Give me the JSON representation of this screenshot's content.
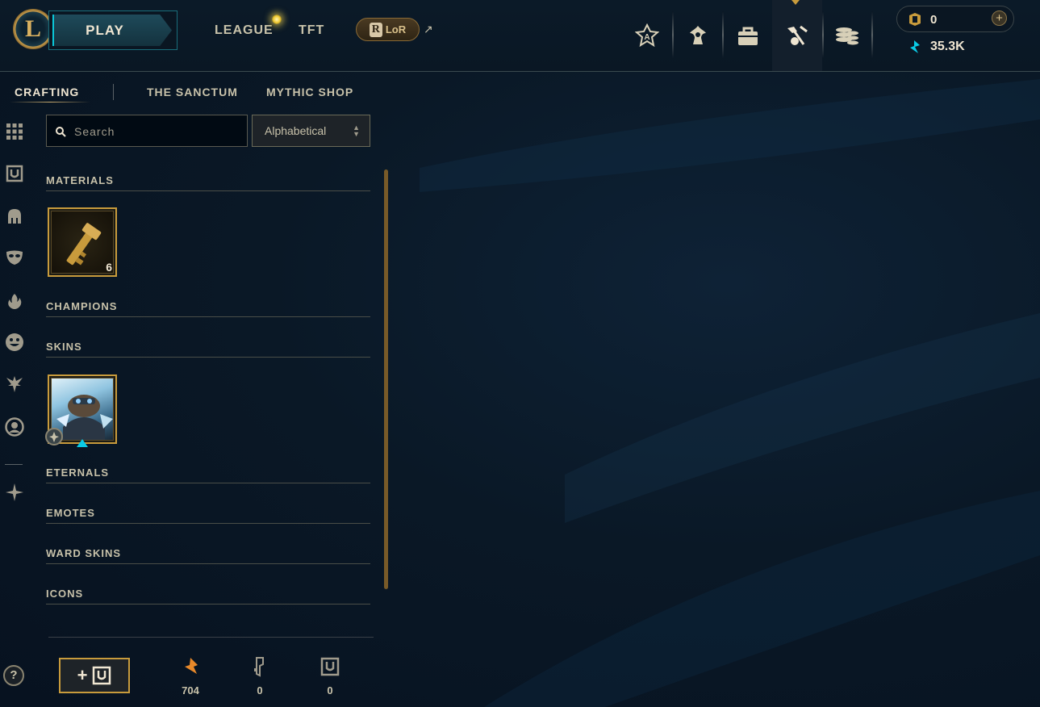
{
  "topbar": {
    "play_label": "PLAY",
    "nav": {
      "league": "LEAGUE",
      "tft": "TFT",
      "lor": "LoR"
    },
    "icons": [
      "challenges-icon",
      "tft-icon",
      "inventory-icon",
      "crafting-icon",
      "store-icon"
    ],
    "active_icon": "crafting-icon",
    "rp_balance": "0",
    "blue_essence": "35.3K"
  },
  "subnav": {
    "crafting": "CRAFTING",
    "sanctum": "THE SANCTUM",
    "mythic_shop": "MYTHIC SHOP",
    "active": "CRAFTING"
  },
  "sidebar_icons": [
    "grid-icon",
    "chest-icon",
    "helmet-icon",
    "mask-icon",
    "flame-icon",
    "emote-icon",
    "ward-icon",
    "profile-icon",
    "crest-icon"
  ],
  "search": {
    "placeholder": "Search",
    "value": ""
  },
  "sort": {
    "selected": "Alphabetical"
  },
  "sections": {
    "materials": "MATERIALS",
    "champions": "CHAMPIONS",
    "skins": "SKINS",
    "eternals": "ETERNALS",
    "emotes": "EMOTES",
    "ward_skins": "WARD SKINS",
    "icons": "ICONS"
  },
  "materials": [
    {
      "name": "key-fragment",
      "count": "6"
    }
  ],
  "skins": [
    {
      "name": "skin-shard"
    }
  ],
  "footer": {
    "add_label": "+",
    "orange_essence": "704",
    "keys": "0",
    "chests": "0"
  },
  "colors": {
    "gold": "#c89b3c",
    "teal": "#0ac8d9",
    "text": "#c8c2aa",
    "background": "#0a1826"
  }
}
